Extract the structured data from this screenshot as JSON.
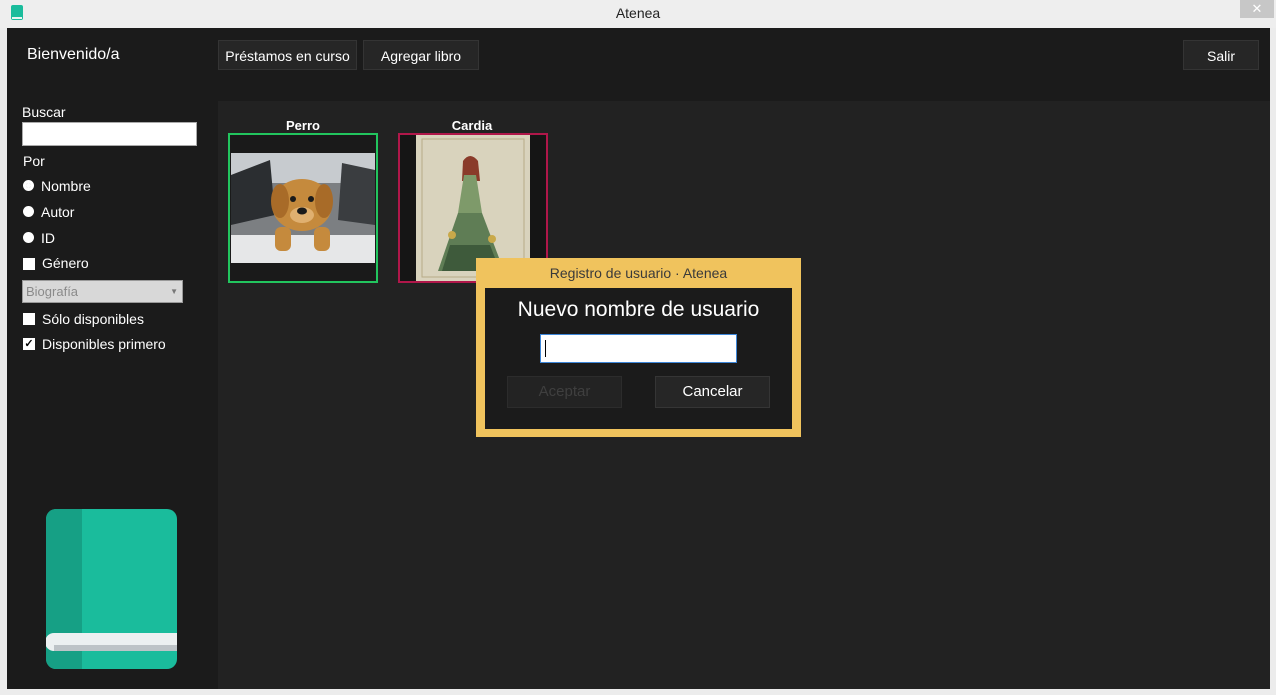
{
  "window": {
    "title": "Atenea",
    "close_glyph": "✕"
  },
  "header": {
    "welcome": "Bienvenido/a",
    "loans_button": "Préstamos en curso",
    "add_book_button": "Agregar libro",
    "exit_button": "Salir"
  },
  "sidebar": {
    "search_label": "Buscar",
    "search_value": "",
    "by_label": "Por",
    "radio_options": [
      {
        "label": "Nombre",
        "selected": true
      },
      {
        "label": "Autor",
        "selected": false
      },
      {
        "label": "ID",
        "selected": false
      }
    ],
    "genre_checkbox": {
      "label": "Género",
      "checked": false
    },
    "genre_select": {
      "selected": "Biografía"
    },
    "only_available": {
      "label": "Sólo disponibles",
      "checked": false
    },
    "available_first": {
      "label": "Disponibles primero",
      "checked": true
    },
    "logo_icon": "book-icon"
  },
  "books": [
    {
      "title": "Perro",
      "border_color": "#22c55e",
      "status": "available"
    },
    {
      "title": "Cardia",
      "border_color": "#b0174a",
      "status": "unavailable"
    }
  ],
  "dialog": {
    "title": "Registro de usuario · Atenea",
    "heading": "Nuevo nombre de usuario",
    "input_value": "",
    "accept_button": "Aceptar",
    "cancel_button": "Cancelar"
  },
  "colors": {
    "accent": "#1abc9c",
    "dialog_frame": "#f0c35d",
    "background": "#1b1b1b"
  }
}
